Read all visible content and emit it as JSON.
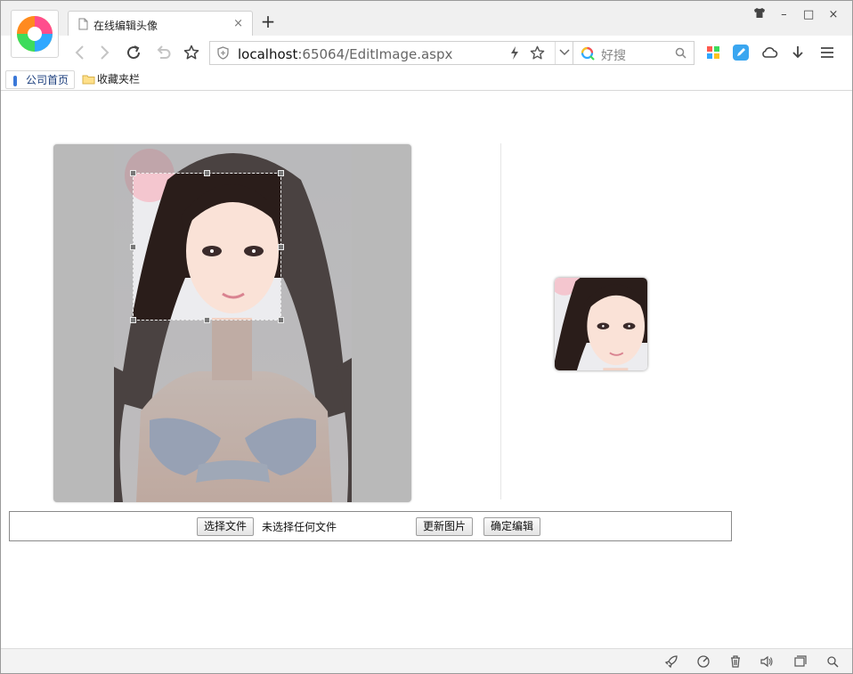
{
  "browser": {
    "tab": {
      "title": "在线编辑头像",
      "close": "×"
    },
    "new_tab": "+",
    "window_controls": {
      "skin": "skin-icon",
      "minimize": "–",
      "maximize": "□",
      "close": "×"
    },
    "address": {
      "host": "localhost",
      "rest": ":65064/EditImage.aspx"
    },
    "search": {
      "placeholder": "好搜"
    },
    "bookmarks": [
      {
        "label": "公司首页",
        "icon": "bookmark-icon"
      },
      {
        "label": "收藏夹栏",
        "icon": "folder-icon"
      }
    ]
  },
  "page": {
    "file_button": "选择文件",
    "file_status": "未选择任何文件",
    "update_button": "更新图片",
    "confirm_button": "确定编辑"
  },
  "colors": {
    "editor_bg": "#b9b9b9",
    "accent_blue": "#2f7be0"
  }
}
